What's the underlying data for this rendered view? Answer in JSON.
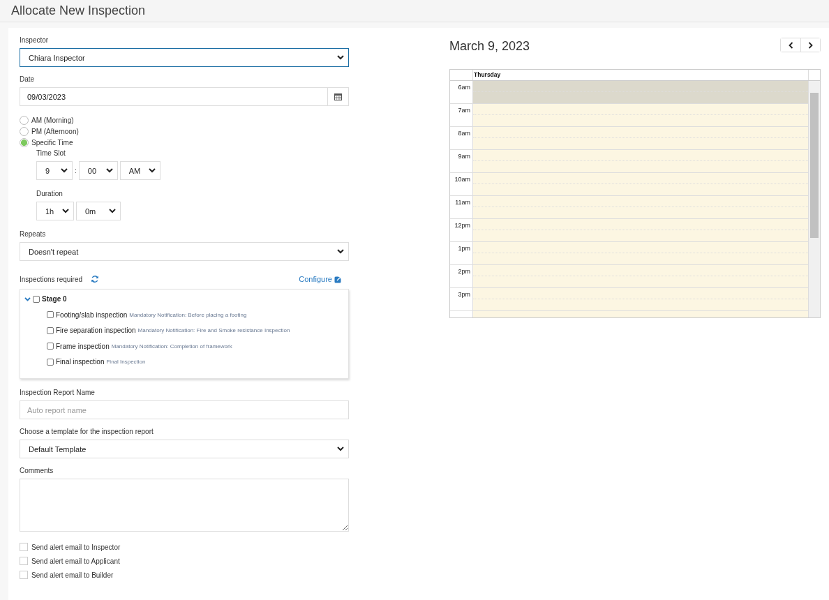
{
  "page": {
    "title": "Allocate New Inspection"
  },
  "form": {
    "inspector": {
      "label": "Inspector",
      "value": "Chiara Inspector",
      "focused": true
    },
    "date": {
      "label": "Date",
      "value": "09/03/2023"
    },
    "time_options": [
      {
        "label": "AM (Morning)",
        "selected": false
      },
      {
        "label": "PM (Afternoon)",
        "selected": false
      },
      {
        "label": "Specific Time",
        "selected": true
      }
    ],
    "time_slot": {
      "label": "Time Slot",
      "hour": "9",
      "separator": ":",
      "minute": "00",
      "period": "AM"
    },
    "duration": {
      "label": "Duration",
      "hours": "1h",
      "minutes": "0m"
    },
    "repeats": {
      "label": "Repeats",
      "value": "Doesn't repeat"
    },
    "inspections": {
      "label": "Inspections required",
      "configure": "Configure",
      "stages": [
        {
          "label": "Stage 0",
          "expanded": true,
          "checked": false,
          "children": [
            {
              "label": "Footing/slab inspection",
              "note": "Mandatory Notification: Before placing a footing",
              "checked": false
            },
            {
              "label": "Fire separation inspection",
              "note": "Mandatory Notification: Fire and Smoke resistance Inspection",
              "checked": false
            },
            {
              "label": "Frame inspection",
              "note": "Mandatory Notification: Completion of framework",
              "checked": false
            },
            {
              "label": "Final inspection",
              "note": "Final Inspection",
              "checked": false
            }
          ]
        }
      ]
    },
    "report_name": {
      "label": "Inspection Report Name",
      "placeholder": "Auto report name"
    },
    "template": {
      "label": "Choose a template for the inspection report",
      "value": "Default Template"
    },
    "comments": {
      "label": "Comments"
    },
    "alerts": [
      {
        "label": "Send alert email to Inspector",
        "checked": false
      },
      {
        "label": "Send alert email to Applicant",
        "checked": false
      },
      {
        "label": "Send alert email to Builder",
        "checked": false
      }
    ]
  },
  "calendar": {
    "title": "March 9, 2023",
    "day": "Thursday",
    "slots": [
      {
        "time": "6am",
        "shaded": true
      },
      {
        "time": "7am",
        "shaded": false
      },
      {
        "time": "8am",
        "shaded": false
      },
      {
        "time": "9am",
        "shaded": false
      },
      {
        "time": "10am",
        "shaded": false
      },
      {
        "time": "11am",
        "shaded": false
      },
      {
        "time": "12pm",
        "shaded": false
      },
      {
        "time": "1pm",
        "shaded": false
      },
      {
        "time": "2pm",
        "shaded": false
      },
      {
        "time": "3pm",
        "shaded": false
      }
    ]
  }
}
